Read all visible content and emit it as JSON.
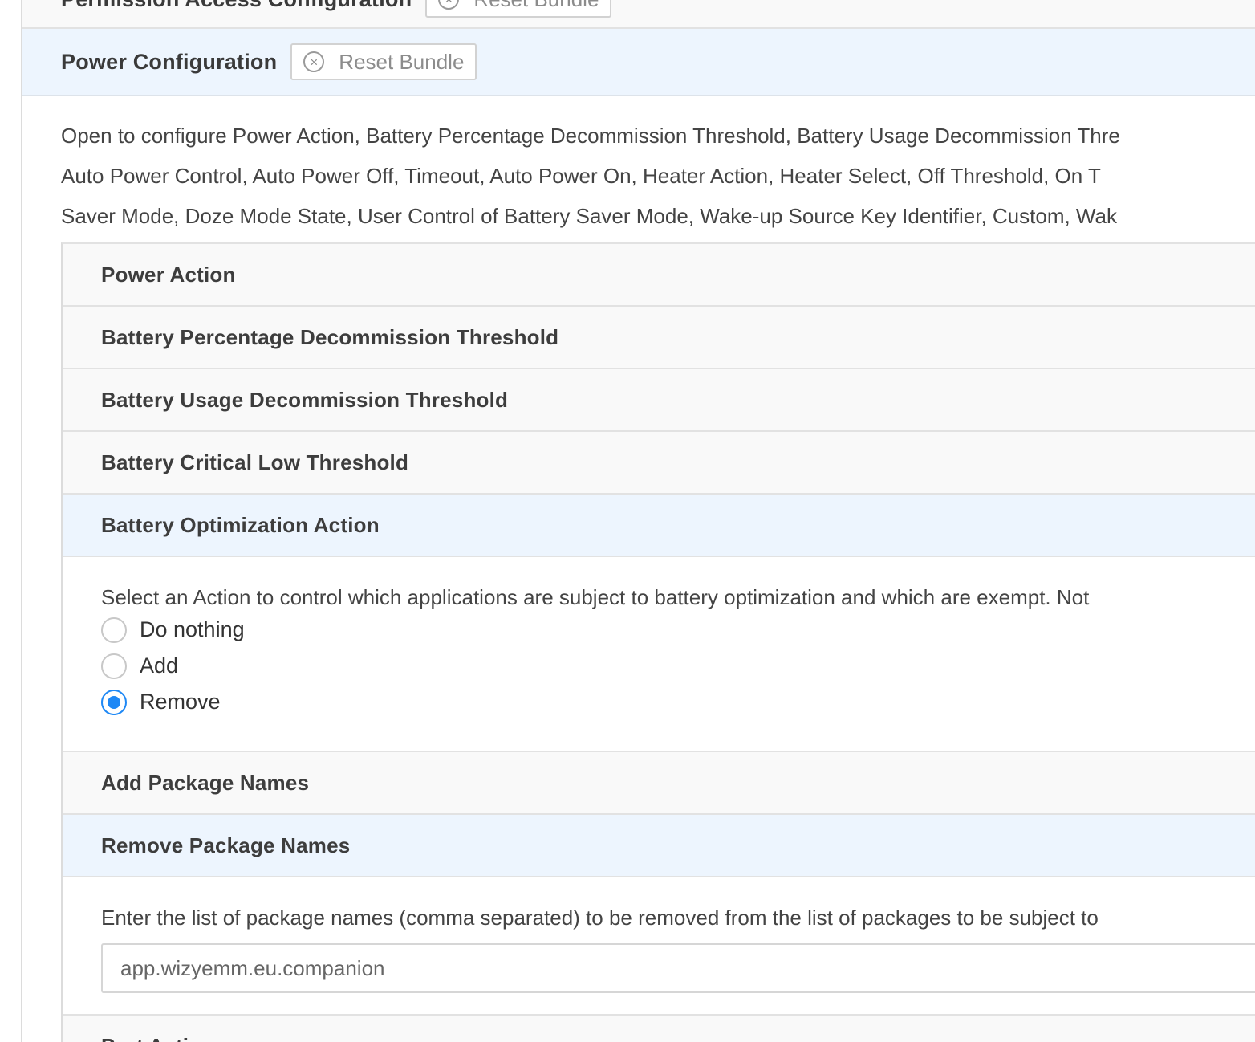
{
  "previous_section": {
    "title": "Permission Access Configuration",
    "reset_label": "Reset Bundle"
  },
  "section": {
    "title": "Power Configuration",
    "reset_label": "Reset Bundle",
    "description_lines": [
      "Open to configure Power Action, Battery Percentage Decommission Threshold, Battery Usage Decommission Thre",
      "Auto Power Control, Auto Power Off, Timeout, Auto Power On, Heater Action, Heater Select, Off Threshold, On T",
      "Saver Mode, Doze Mode State, User Control of Battery Saver Mode, Wake-up Source Key Identifier, Custom, Wak"
    ]
  },
  "accordion": {
    "power_action": "Power Action",
    "battery_percentage": "Battery Percentage Decommission Threshold",
    "battery_usage": "Battery Usage Decommission Threshold",
    "battery_critical": "Battery Critical Low Threshold",
    "battery_optimization": {
      "title": "Battery Optimization Action",
      "description": "Select an Action to control which applications are subject to battery optimization and which are exempt. Not",
      "options": [
        "Do nothing",
        "Add",
        "Remove"
      ],
      "selected": "Remove"
    },
    "add_package": "Add Package Names",
    "remove_package": {
      "title": "Remove Package Names",
      "description": "Enter the list of package names (comma separated) to be removed from the list of packages to be subject to",
      "value": "app.wizyemm.eu.companion"
    },
    "next_item": "Port Action"
  },
  "icons": {
    "reset": "close-circle-icon"
  },
  "colors": {
    "active_header_bg": "#edf5fe",
    "radio_checked": "#1e88f5"
  }
}
